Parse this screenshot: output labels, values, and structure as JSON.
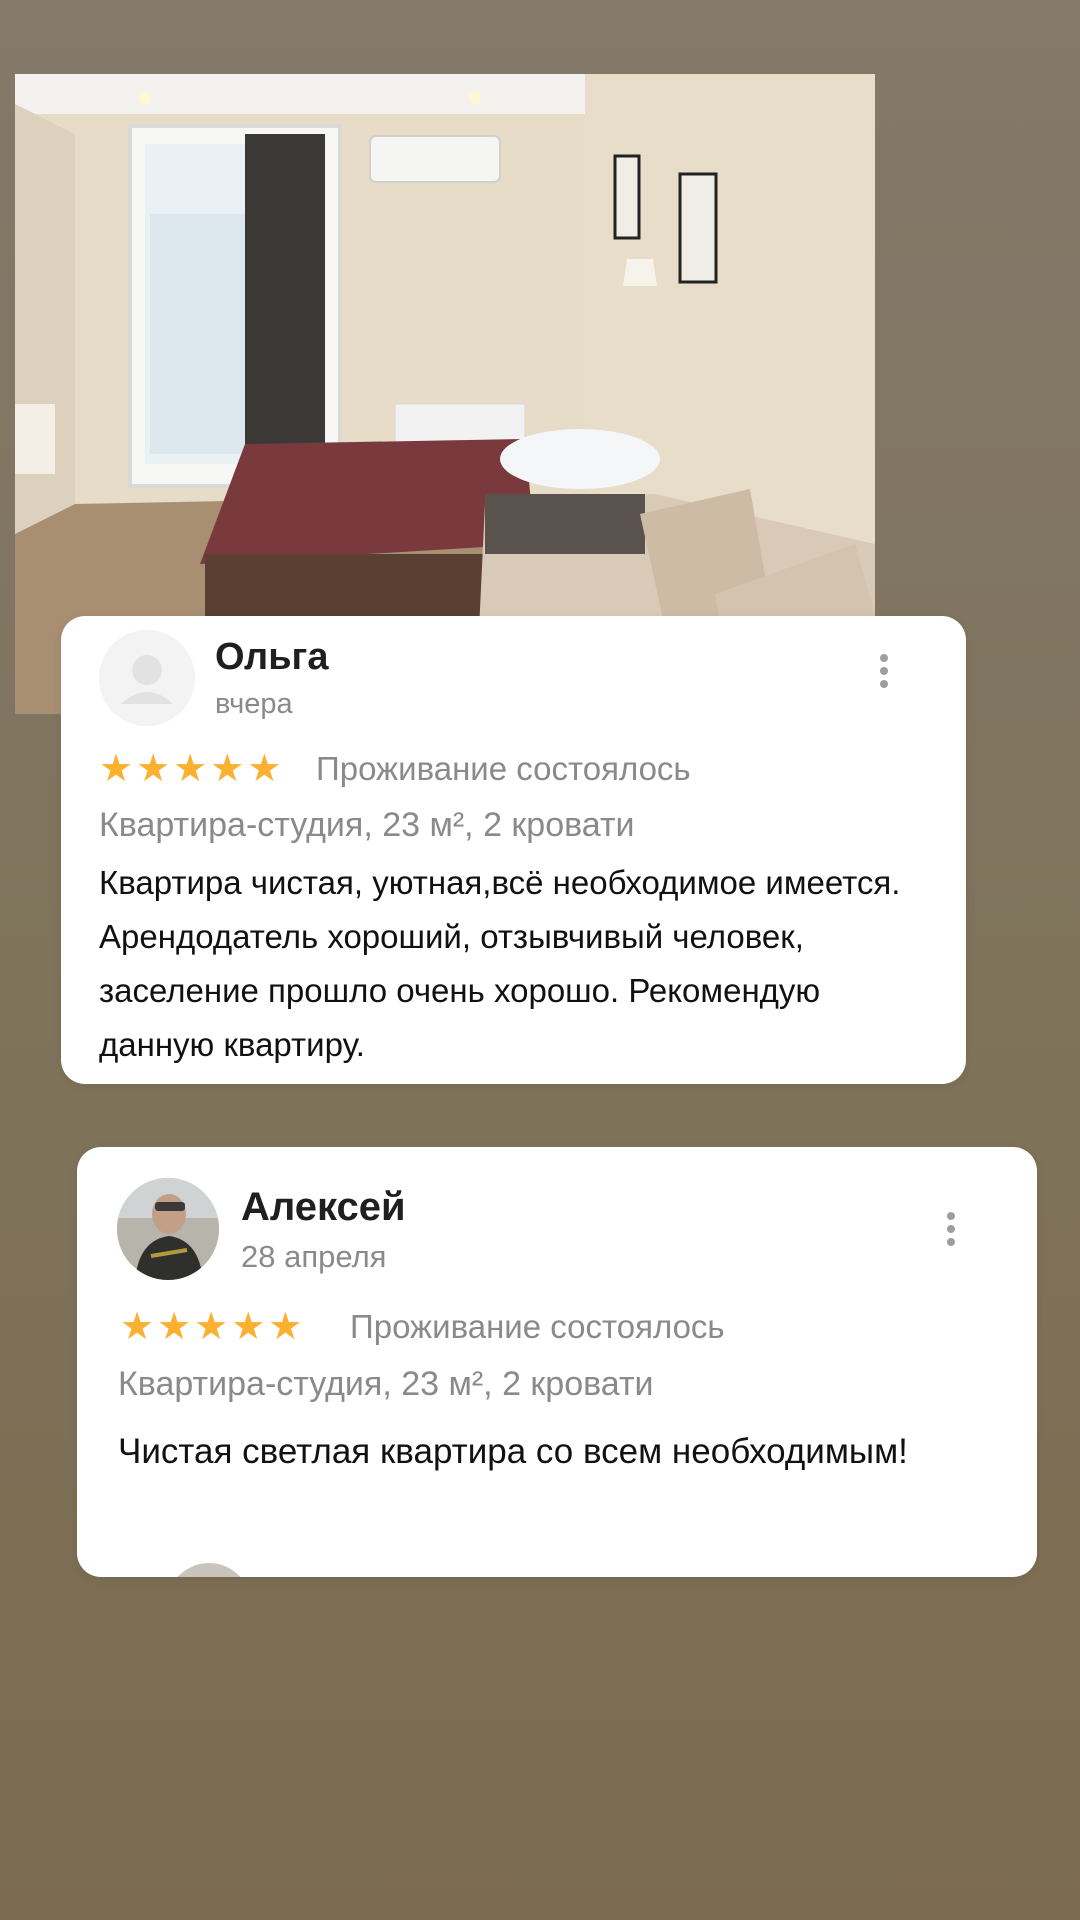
{
  "reviews": [
    {
      "author": "Ольга",
      "date": "вчера",
      "rating": 5,
      "stars": [
        "★",
        "★",
        "★",
        "★",
        "★"
      ],
      "status": "Проживание состоялось",
      "meta": "Квартира-студия, 23 м², 2 кровати",
      "text": "Квартира чистая, уютная,всё необходимое имеется. Арендодатель хороший, отзывчивый человек,  заселение прошло очень хорошо. Рекомендую данную квартиру.",
      "avatar": "placeholder-person-icon"
    },
    {
      "author": "Алексей",
      "date": "28 апреля",
      "rating": 5,
      "stars": [
        "★",
        "★",
        "★",
        "★",
        "★"
      ],
      "status": "Проживание состоялось",
      "meta": "Квартира-студия, 23 м², 2 кровати",
      "text": "Чистая светлая квартира со всем необходимым!",
      "avatar": "user-photo"
    }
  ],
  "colors": {
    "background": "#807460",
    "card": "#ffffff",
    "star": "#fbb02f",
    "muted_text": "#8a8a8a",
    "body_text": "#111111"
  },
  "icons": {
    "menu": "more-vertical-icon",
    "rating": "star-icon"
  }
}
